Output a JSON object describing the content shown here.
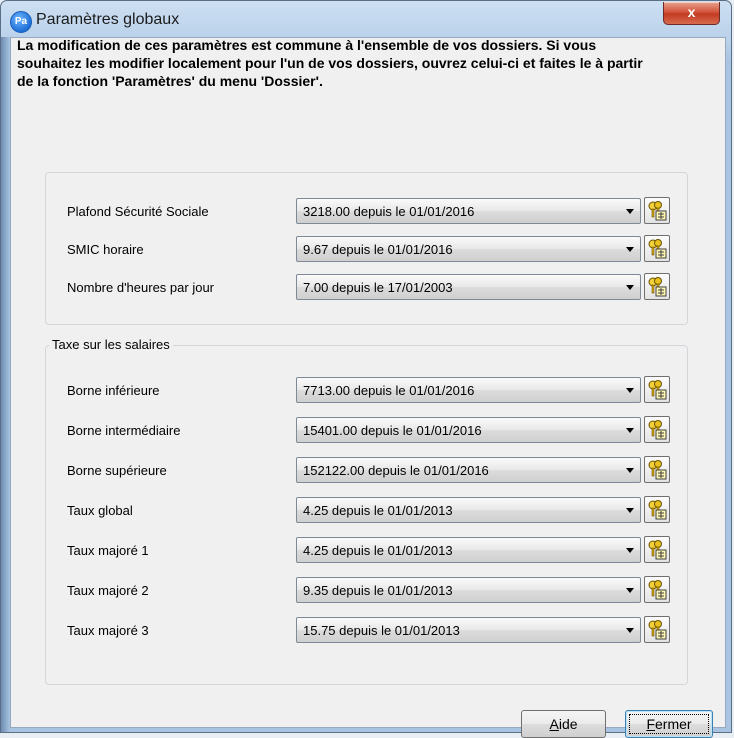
{
  "window": {
    "title": "Paramètres globaux",
    "icon_text": "Pa",
    "close_glyph": "x"
  },
  "intro_text": "La modification de ces paramètres est commune à l'ensemble de vos dossiers. Si vous souhaitez les modifier localement pour l'un de vos dossiers, ouvrez celui-ci et faites le à partir de la fonction 'Paramètres' du menu 'Dossier'.",
  "group_general": {
    "rows": [
      {
        "label": "Plafond Sécurité Sociale",
        "value": "3218.00 depuis le 01/01/2016"
      },
      {
        "label": "SMIC horaire",
        "value": "9.67 depuis le 01/01/2016"
      },
      {
        "label": "Nombre d'heures par jour",
        "value": "7.00 depuis le 17/01/2003"
      }
    ]
  },
  "group_taxe": {
    "legend": "Taxe sur les salaires",
    "rows": [
      {
        "label": "Borne inférieure",
        "value": "7713.00 depuis le 01/01/2016"
      },
      {
        "label": "Borne intermédiaire",
        "value": "15401.00 depuis le 01/01/2016"
      },
      {
        "label": "Borne supérieure",
        "value": "152122.00 depuis le 01/01/2016"
      },
      {
        "label": "Taux global",
        "value": "4.25 depuis le 01/01/2013"
      },
      {
        "label": "Taux majoré 1",
        "value": "4.25 depuis le 01/01/2013"
      },
      {
        "label": "Taux majoré 2",
        "value": "9.35 depuis le 01/01/2013"
      },
      {
        "label": "Taux majoré 3",
        "value": "15.75 depuis le 01/01/2013"
      }
    ]
  },
  "buttons": {
    "aide_first": "A",
    "aide_rest": "ide",
    "fermer_first": "F",
    "fermer_rest": "ermer"
  },
  "icons": {
    "edit_button": "keys-edit-icon",
    "dropdown": "chevron-down-icon"
  }
}
